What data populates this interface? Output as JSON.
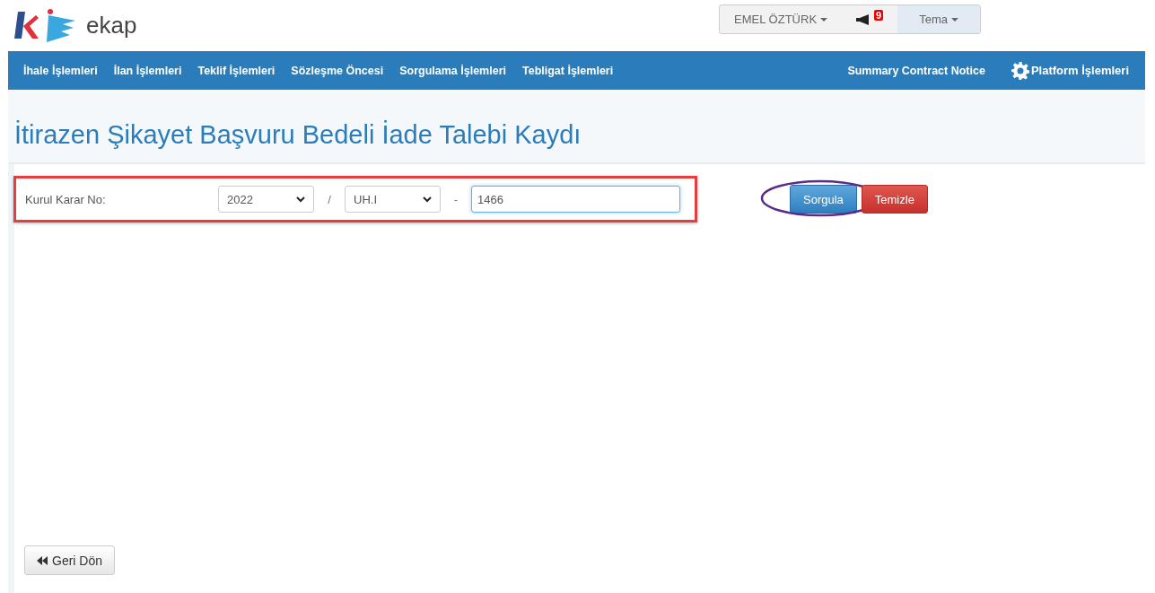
{
  "header": {
    "logo_text": "ekap",
    "user_menu": "EMEL ÖZTÜRK",
    "notification_count": "9",
    "theme_menu": "Tema"
  },
  "nav": {
    "items": [
      "İhale İşlemleri",
      "İlan İşlemleri",
      "Teklif İşlemleri",
      "Sözleşme Öncesi",
      "Sorgulama İşlemleri",
      "Tebligat İşlemleri"
    ],
    "right_items": [
      {
        "label": "Summary Contract Notice",
        "kind": "link"
      },
      {
        "label": "Platform İşlemleri",
        "kind": "gear"
      }
    ]
  },
  "page": {
    "title": "İtirazen Şikayet Başvuru Bedeli İade Talebi Kaydı"
  },
  "form": {
    "label": "Kurul Karar No:",
    "year": "2022",
    "separator_1": "/",
    "type": "UH.I",
    "separator_2": "-",
    "number": "1466",
    "highlighted": true
  },
  "buttons": [
    {
      "label": "Sorgula",
      "kind": "primary",
      "circled": true
    },
    {
      "label": "Temizle",
      "kind": "danger",
      "circled": false
    }
  ],
  "back_button": "Geri Dön"
}
